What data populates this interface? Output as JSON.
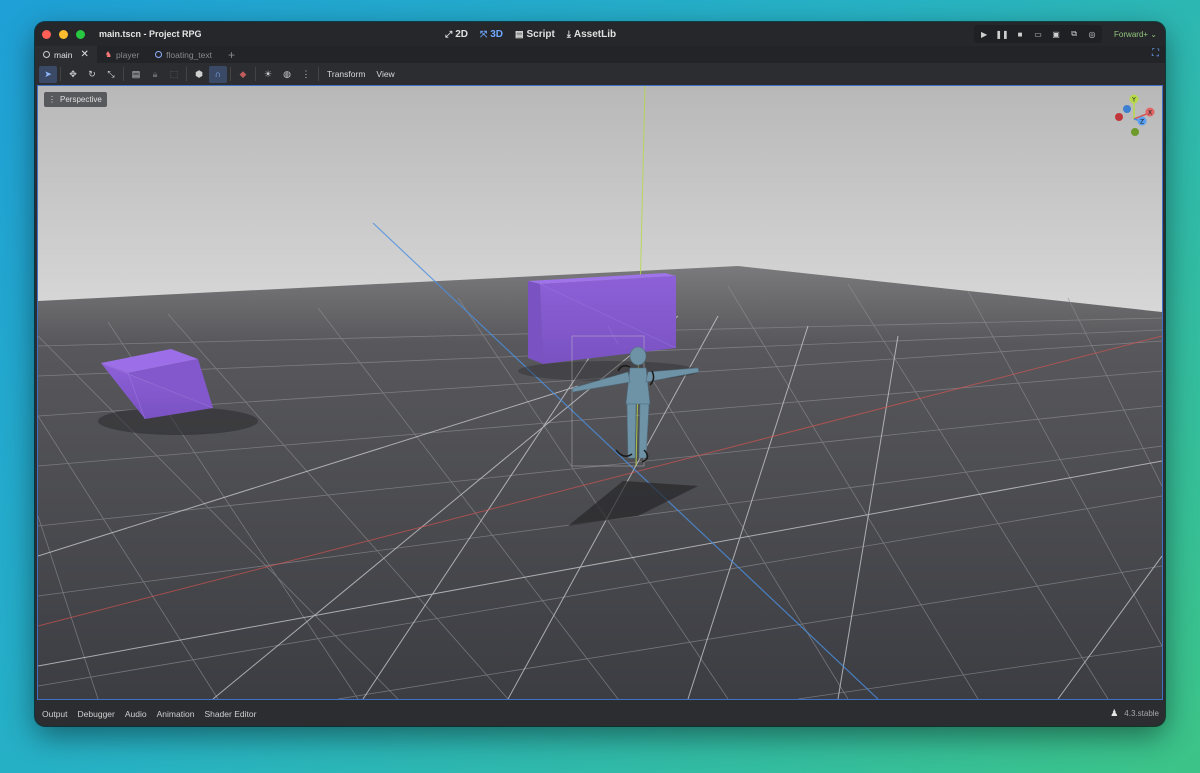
{
  "window": {
    "title": "main.tscn - Project RPG"
  },
  "main_modes": [
    {
      "label": "2D",
      "icon": "2d-icon",
      "glyph": "⤢",
      "active": false
    },
    {
      "label": "3D",
      "icon": "3d-icon",
      "glyph": "⤧",
      "active": true
    },
    {
      "label": "Script",
      "icon": "script-icon",
      "glyph": "▤",
      "active": false
    },
    {
      "label": "AssetLib",
      "icon": "assetlib-icon",
      "glyph": "⤓",
      "active": false
    }
  ],
  "run_controls": {
    "renderer": "Forward+"
  },
  "scene_tabs": [
    {
      "label": "main",
      "active": true
    },
    {
      "label": "player",
      "active": false
    },
    {
      "label": "floating_text",
      "active": false
    }
  ],
  "toolbar": {
    "transform_menu": "Transform",
    "view_menu": "View"
  },
  "viewport": {
    "perspective_label": "Perspective",
    "gizmo": {
      "x": "X",
      "y": "Y",
      "z": "Z"
    },
    "colors": {
      "box": "#8a5cd6",
      "x_axis": "#d9534f",
      "y_axis": "#b7d94a",
      "z_axis": "#4a90e2",
      "selection": "#3f72c4"
    }
  },
  "bottom_panel": {
    "tabs": [
      "Output",
      "Debugger",
      "Audio",
      "Animation",
      "Shader Editor"
    ],
    "version": "4.3.stable"
  }
}
